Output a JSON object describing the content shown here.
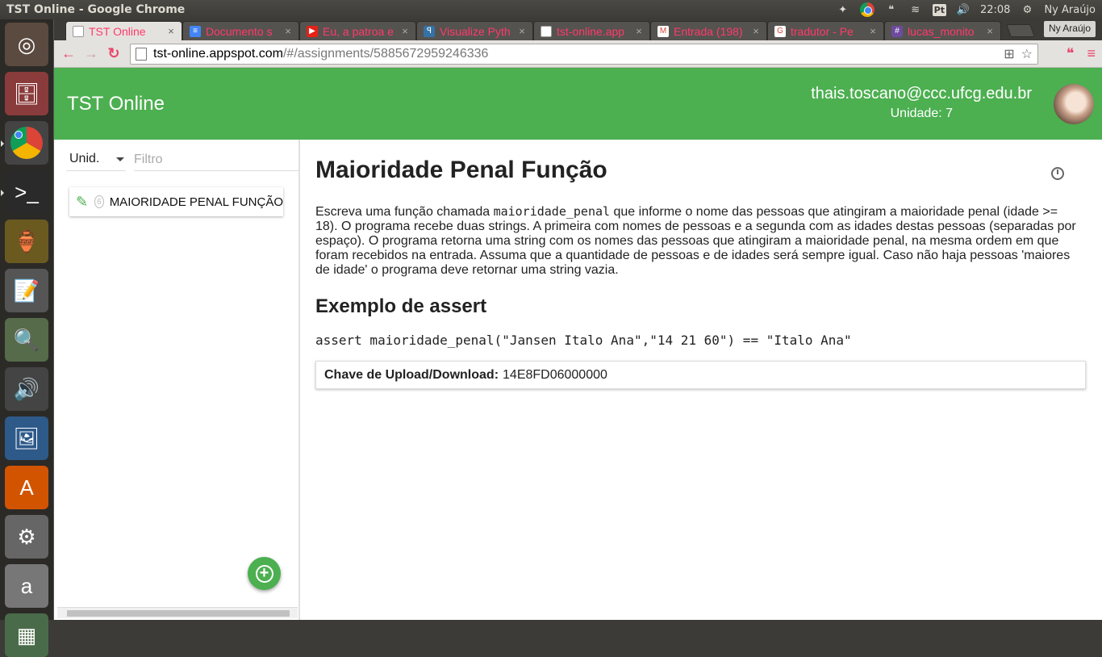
{
  "os": {
    "window_title": "TST Online - Google Chrome",
    "clock": "22:08",
    "user_name": "Ny Araújo",
    "keyboard_layout": "Pt",
    "launcher": [
      {
        "name": "dash-icon",
        "glyph": "◎"
      },
      {
        "name": "files-icon",
        "glyph": "🗄"
      },
      {
        "name": "chrome-icon",
        "glyph": ""
      },
      {
        "name": "terminal-icon",
        "glyph": ">_"
      },
      {
        "name": "genie-icon",
        "glyph": "🏺"
      },
      {
        "name": "text-editor-icon",
        "glyph": "📝"
      },
      {
        "name": "image-viewer-icon",
        "glyph": "🔍"
      },
      {
        "name": "audio-icon",
        "glyph": "🔊"
      },
      {
        "name": "writer-icon",
        "glyph": "🖼"
      },
      {
        "name": "software-center-icon",
        "glyph": "A"
      },
      {
        "name": "updater-icon",
        "glyph": "⚙"
      },
      {
        "name": "amazon-icon",
        "glyph": "a"
      },
      {
        "name": "workspaces-icon",
        "glyph": "▦"
      }
    ]
  },
  "browser": {
    "profile_name": "Ny Araújo",
    "tabs": [
      {
        "title": "TST Online",
        "favicon": "doc-icon",
        "active": true
      },
      {
        "title": "Documento s",
        "favicon": "docs-icon",
        "active": false
      },
      {
        "title": "Eu, a patroa e",
        "favicon": "youtube-icon",
        "active": false
      },
      {
        "title": "Visualize Pyth",
        "favicon": "python-icon",
        "active": false
      },
      {
        "title": "tst-online.app",
        "favicon": "doc-icon",
        "active": false
      },
      {
        "title": "Entrada (198)",
        "favicon": "gmail-icon",
        "active": false
      },
      {
        "title": "tradutor - Pe",
        "favicon": "google-icon",
        "active": false
      },
      {
        "title": "lucas_monito",
        "favicon": "slack-icon",
        "active": false
      }
    ],
    "url_host": "tst-online.appspot.com",
    "url_path": "/#/assignments/5885672959246336"
  },
  "app": {
    "title": "TST Online",
    "user_email": "thais.toscano@ccc.ufcg.edu.br",
    "user_unit": "Unidade: 7",
    "accent_color": "#4caf50",
    "sidebar": {
      "unit_select_label": "Unid.",
      "filter_placeholder": "Filtro",
      "assignments": [
        {
          "unit": "6",
          "title": "MAIORIDADE PENAL FUNÇÃO"
        }
      ]
    },
    "assignment": {
      "heading": "Maioridade Penal Função",
      "description_before": "Escreva uma função chamada ",
      "function_name": "maioridade_penal",
      "description_after": " que informe o nome das pessoas que atingiram a maioridade penal (idade >= 18). O programa recebe duas strings. A primeira com nomes de pessoas e a segunda com as idades destas pessoas (separadas por espaço). O programa retorna uma string com os nomes das pessoas que atingiram a maioridade penal, na mesma ordem em que foram recebidos na entrada. Assuma que a quantidade de pessoas e de idades será sempre igual. Caso não haja pessoas 'maiores de idade' o programa deve retornar uma string vazia.",
      "example_heading": "Exemplo de assert",
      "assert_code": "assert maioridade_penal(\"Jansen Italo Ana\",\"14 21 60\") == \"Italo Ana\"",
      "key_label": "Chave de Upload/Download:",
      "key_value": "14E8FD06000000"
    }
  }
}
